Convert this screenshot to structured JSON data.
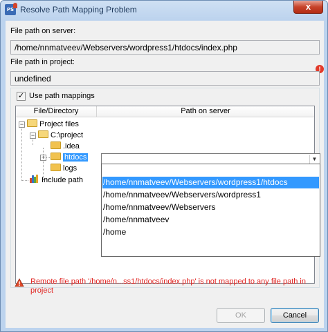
{
  "window": {
    "title": "Resolve Path Mapping Problem",
    "close_glyph": "x"
  },
  "server_path": {
    "label": "File path on server:",
    "value": "/home/nnmatveev/Webservers/wordpress1/htdocs/index.php"
  },
  "project_path": {
    "label": "File path in project:",
    "value": "undefined",
    "warning_glyph": "!"
  },
  "mappings": {
    "checkbox_label": "Use path mappings",
    "checked": true,
    "columns": [
      "File/Directory",
      "Path on server"
    ],
    "tree": {
      "root": "Project files",
      "project": "C:\\project",
      "children": [
        ".idea",
        "htdocs",
        "logs"
      ],
      "include": "Include path"
    },
    "combo_value": "",
    "options": [
      "",
      "/home/nnmatveev/Webservers/wordpress1/htdocs",
      "/home/nnmatveev/Webservers/wordpress1",
      "/home/nnmatveev/Webservers",
      "/home/nnmatveev",
      "/home"
    ],
    "selected_option_index": 1
  },
  "error": {
    "message": "Remote file path '/home/n...ss1/htdocs/index.php' is not mapped to any file path in project"
  },
  "buttons": {
    "ok": "OK",
    "cancel": "Cancel"
  },
  "colors": {
    "selection": "#3399ff",
    "error": "#e0221f",
    "title_text": "#1e395b"
  },
  "icons": {
    "app": "phpstorm-icon",
    "folder": "folder-icon",
    "library": "library-icon",
    "error": "error-icon"
  }
}
